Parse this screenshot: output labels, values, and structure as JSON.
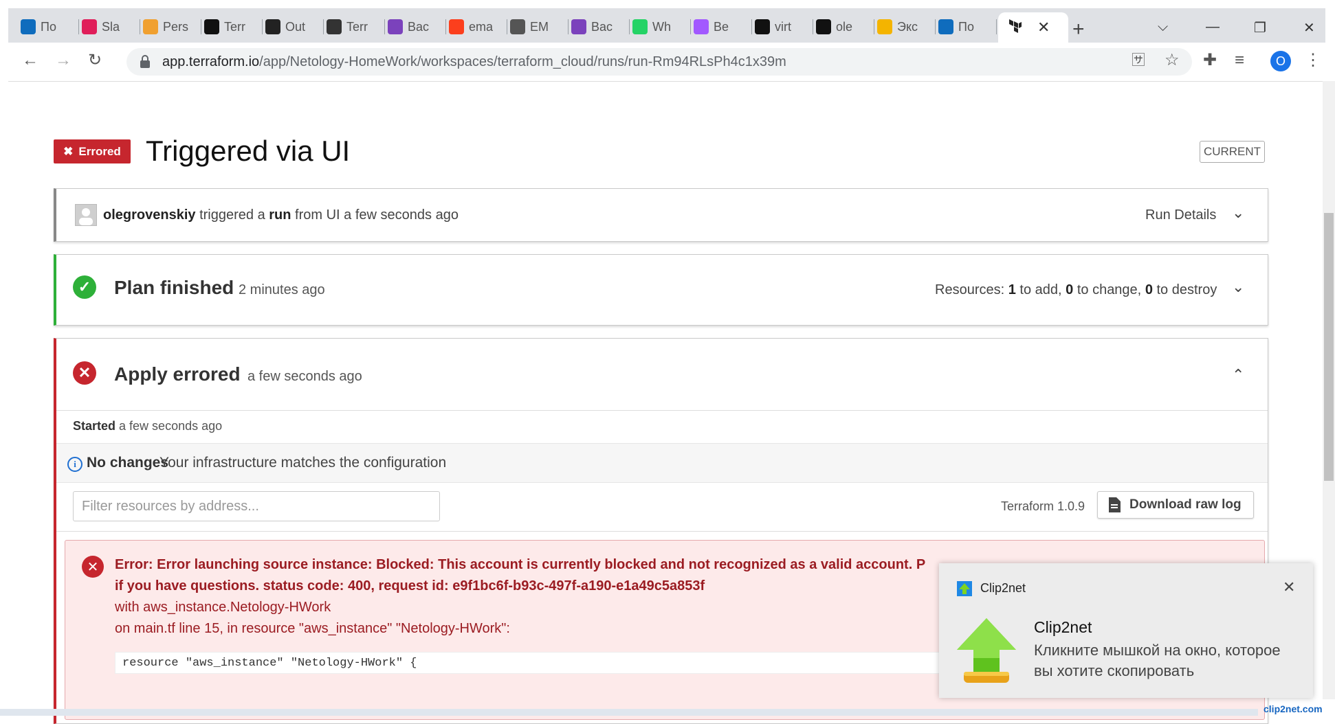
{
  "browser": {
    "tabs": [
      {
        "label": "По",
        "icon": "outlook-icon",
        "color": "#0f6cbd"
      },
      {
        "label": "Sla",
        "icon": "slack-icon",
        "color": "#e01e5a"
      },
      {
        "label": "Pers",
        "icon": "box-icon",
        "color": "#f0a030"
      },
      {
        "label": "Terr",
        "icon": "medium-icon",
        "color": "#111111"
      },
      {
        "label": "Out",
        "icon": "hashicorp-icon",
        "color": "#222222"
      },
      {
        "label": "Terr",
        "icon": "terraform-h-icon",
        "color": "#333333"
      },
      {
        "label": "Вас",
        "icon": "terraform-icon",
        "color": "#7b42bc"
      },
      {
        "label": "ema",
        "icon": "yandex-icon",
        "color": "#fc3f1d"
      },
      {
        "label": "EM",
        "icon": "globe-icon",
        "color": "#555555"
      },
      {
        "label": "Вас",
        "icon": "terraform-icon",
        "color": "#7b42bc"
      },
      {
        "label": "Wh",
        "icon": "whatsapp-icon",
        "color": "#25d366"
      },
      {
        "label": "Ве",
        "icon": "figma-icon",
        "color": "#a259ff"
      },
      {
        "label": "virt",
        "icon": "github-icon",
        "color": "#111111"
      },
      {
        "label": "ole",
        "icon": "github-icon",
        "color": "#111111"
      },
      {
        "label": "Экс",
        "icon": "mail-at-icon",
        "color": "#f4b400"
      },
      {
        "label": "По",
        "icon": "mail-icon",
        "color": "#0f6cbd"
      }
    ],
    "active_tab_icon": "terraform-icon",
    "url_host": "app.terraform.io",
    "url_path": "/app/Netology-HomeWork/workspaces/terraform_cloud/runs/run-Rm94RLsPh4c1x39m",
    "profile_initial": "O"
  },
  "run": {
    "status_badge": "Errored",
    "title": "Triggered via UI",
    "current_label": "CURRENT",
    "trigger": {
      "user": "olegrovenskiy",
      "text_1": "triggered a",
      "run_word": "run",
      "text_2": "from UI a few seconds ago",
      "details_label": "Run Details"
    },
    "plan": {
      "title": "Plan finished",
      "time": "2 minutes ago",
      "resources_label": "Resources:",
      "add_count": "1",
      "add_label": "to add,",
      "change_count": "0",
      "change_label": "to change,",
      "destroy_count": "0",
      "destroy_label": "to destroy"
    },
    "apply": {
      "title": "Apply errored",
      "time": "a few seconds ago",
      "started_label": "Started",
      "started_time": "a few seconds ago",
      "no_changes_title": "No changes",
      "no_changes_desc": "Your infrastructure matches the configuration",
      "filter_placeholder": "Filter resources by address...",
      "terraform_version": "Terraform 1.0.9",
      "download_label": "Download raw log",
      "error": {
        "line1": "Error: Error launching source instance: Blocked: This account is currently blocked and not recognized as a valid account. P",
        "line2": "if you have questions. status code: 400, request id: e9f1bc6f-b93c-497f-a190-e1a49c5a853f",
        "line3": "with aws_instance.Netology-HWork",
        "line4": "on main.tf line 15, in resource \"aws_instance\" \"Netology-HWork\":",
        "code": "resource \"aws_instance\" \"Netology-HWork\" {"
      }
    }
  },
  "notification": {
    "app": "Clip2net",
    "title": "Clip2net",
    "message": "Кликните мышкой на окно, которое вы хотите скопировать"
  },
  "watermark": "clip2net.com",
  "colors": {
    "error": "#c6262e",
    "success": "#2eb039",
    "info": "#1f6fd1"
  }
}
